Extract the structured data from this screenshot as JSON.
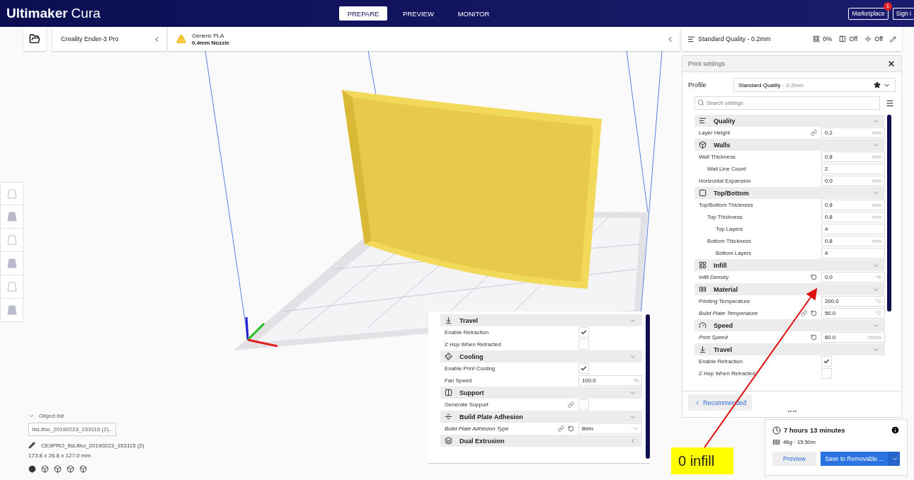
{
  "app": {
    "brand": "Ultimaker",
    "product": "Cura"
  },
  "stages": [
    {
      "label": "PREPARE",
      "selected": true
    },
    {
      "label": "PREVIEW",
      "selected": false
    },
    {
      "label": "MONITOR",
      "selected": false
    }
  ],
  "account": {
    "marketplace": "Marketplace",
    "badge": "1",
    "sign_in": "Sign i"
  },
  "printer": {
    "name": "Creality Ender-3 Pro"
  },
  "material": {
    "name": "Generic PLA",
    "nozzle": "0.4mm Nozzle",
    "warning": true
  },
  "quality_bar": {
    "profile": "Standard Quality - 0.2mm",
    "infill": "0%",
    "support": "Off",
    "adhesion": "Off"
  },
  "print_settings": {
    "title": "Print settings",
    "profile_label": "Profile",
    "profile": "Standard Quality",
    "profile_detail": "- 0.2mm",
    "search_placeholder": "Search settings",
    "recommended_button": "Recommended",
    "categories": [
      {
        "kind": "quality",
        "title": "Quality",
        "expanded": true,
        "settings": [
          {
            "label": "Layer Height",
            "kind": "number",
            "value": "0.2",
            "unit": "mm",
            "modified": false,
            "linked": true
          }
        ]
      },
      {
        "kind": "walls",
        "title": "Walls",
        "expanded": true,
        "settings": [
          {
            "label": "Wall Thickness",
            "kind": "number",
            "value": "0.8",
            "unit": "mm",
            "modified": false,
            "children": [
              {
                "label": "Wall Line Count",
                "kind": "number",
                "value": "2",
                "modified": false
              }
            ]
          },
          {
            "label": "Horizontal Expansion",
            "kind": "number",
            "value": "0.0",
            "unit": "mm",
            "modified": false
          }
        ]
      },
      {
        "kind": "top_bottom",
        "title": "Top/Bottom",
        "expanded": true,
        "settings": [
          {
            "label": "Top/Bottom Thickness",
            "kind": "number",
            "value": "0.8",
            "unit": "mm",
            "modified": false,
            "children": [
              {
                "label": "Top Thickness",
                "kind": "number",
                "value": "0.8",
                "unit": "mm",
                "modified": false,
                "children": [
                  {
                    "label": "Top Layers",
                    "kind": "number",
                    "value": "4",
                    "modified": false
                  }
                ]
              },
              {
                "label": "Bottom Thickness",
                "kind": "number",
                "value": "0.8",
                "unit": "mm",
                "modified": false,
                "children": [
                  {
                    "label": "Bottom Layers",
                    "kind": "number",
                    "value": "4",
                    "modified": false
                  }
                ]
              }
            ]
          }
        ]
      },
      {
        "kind": "infill",
        "title": "Infill",
        "expanded": true,
        "settings": [
          {
            "label": "Infill Density",
            "kind": "number",
            "value": "0.0",
            "unit": "%",
            "modified": true,
            "resettable": true
          }
        ]
      },
      {
        "kind": "material",
        "title": "Material",
        "expanded": true,
        "settings": [
          {
            "label": "Printing Temperature",
            "kind": "number",
            "value": "200.0",
            "unit": "°C",
            "modified": false
          },
          {
            "label": "Build Plate Temperature",
            "kind": "number",
            "value": "50.0",
            "unit": "°C",
            "modified": true,
            "linked": true,
            "resettable": true
          }
        ]
      },
      {
        "kind": "speed",
        "title": "Speed",
        "expanded": true,
        "settings": [
          {
            "label": "Print Speed",
            "kind": "number",
            "value": "60.0",
            "unit": "mm/s",
            "modified": true,
            "resettable": true
          }
        ]
      },
      {
        "kind": "travel",
        "title": "Travel",
        "expanded": true,
        "settings": [
          {
            "label": "Enable Retraction",
            "kind": "check",
            "checked": true,
            "modified": false
          },
          {
            "label": "Z Hop When Retracted",
            "kind": "check",
            "checked": false,
            "modified": false
          }
        ]
      }
    ]
  },
  "overlay_settings": {
    "categories": [
      {
        "kind": "travel",
        "title": "Travel",
        "expanded": true,
        "settings": [
          {
            "label": "Enable Retraction",
            "kind": "check",
            "checked": true,
            "modified": false
          },
          {
            "label": "Z Hop When Retracted",
            "kind": "check",
            "checked": false,
            "modified": false
          }
        ]
      },
      {
        "kind": "cooling",
        "title": "Cooling",
        "expanded": true,
        "settings": [
          {
            "label": "Enable Print Cooling",
            "kind": "check",
            "checked": true,
            "modified": false
          },
          {
            "label": "Fan Speed",
            "kind": "number",
            "value": "100.0",
            "unit": "%",
            "modified": false
          }
        ]
      },
      {
        "kind": "support",
        "title": "Support",
        "expanded": true,
        "settings": [
          {
            "label": "Generate Support",
            "kind": "check",
            "checked": false,
            "modified": false,
            "linked": true
          }
        ]
      },
      {
        "kind": "adhesion",
        "title": "Build Plate Adhesion",
        "expanded": true,
        "settings": [
          {
            "label": "Build Plate Adhesion Type",
            "kind": "select",
            "value": "Brim",
            "modified": true,
            "linked": true,
            "resettable": true
          }
        ]
      },
      {
        "kind": "dual",
        "title": "Dual Extrusion",
        "expanded": false
      }
    ]
  },
  "estimate": {
    "time": "7 hours 13 minutes",
    "material": "46g · 15.50m",
    "preview_button": "Preview",
    "save_button": "Save to Removable ..."
  },
  "object_list": {
    "title": "Object list",
    "expanded": true,
    "items": [
      {
        "name": "ItsLitho_20190223_153115 (2)...",
        "selected": true
      }
    ],
    "object_name": "CE3PRO_ItsLitho_20190223_153115 (2)",
    "dimensions": "173.8 x 26.8 x 127.0 mm"
  },
  "annotation": {
    "text": "0 infill"
  }
}
